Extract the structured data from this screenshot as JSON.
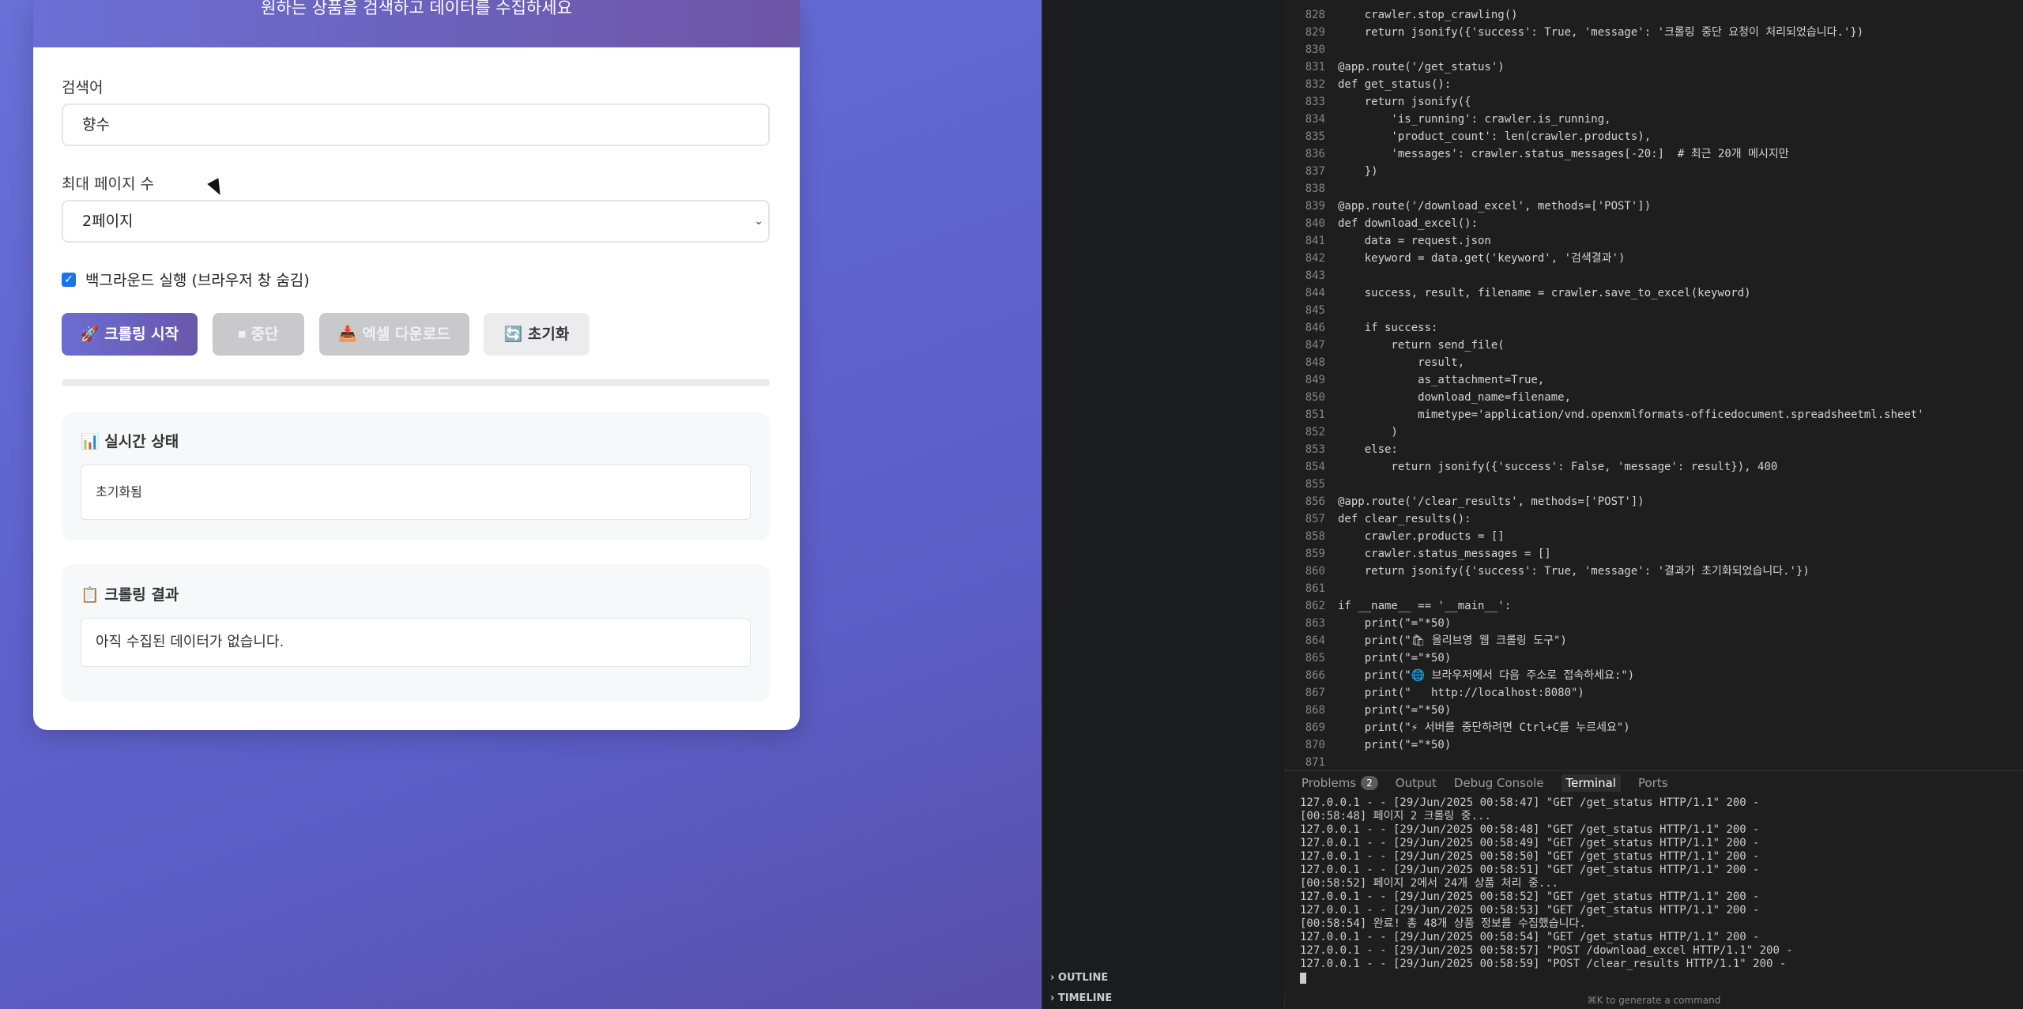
{
  "browser": {
    "header_subtitle": "원하는 상품을 검색하고 데이터를 수집하세요",
    "keyword_label": "검색어",
    "keyword_value": "향수",
    "pages_label": "최대 페이지 수",
    "pages_value": "2페이지",
    "background_checkbox_label": "백그라운드 실행 (브라우저 창 숨김)",
    "background_checked": true,
    "buttons": {
      "start": "🚀 크롤링 시작",
      "stop": "⏹ 중단",
      "download": "📥 엑셀 다운로드",
      "reset": "🔄 초기화"
    },
    "status_title": "📊 실시간 상태",
    "status_text": "초기화됨",
    "results_title": "📋 크롤링 결과",
    "results_text": "아직 수집된 데이터가 없습니다."
  },
  "editor": {
    "side_sections": [
      "OUTLINE",
      "TIMELINE"
    ],
    "code_lines": [
      {
        "num": "828",
        "text": "    crawler.stop_crawling()"
      },
      {
        "num": "829",
        "text": "    return jsonify({'success': True, 'message': '크롤링 중단 요청이 처리되었습니다.'})"
      },
      {
        "num": "830",
        "text": ""
      },
      {
        "num": "831",
        "text": "@app.route('/get_status')"
      },
      {
        "num": "832",
        "text": "def get_status():"
      },
      {
        "num": "833",
        "text": "    return jsonify({"
      },
      {
        "num": "834",
        "text": "        'is_running': crawler.is_running,"
      },
      {
        "num": "835",
        "text": "        'product_count': len(crawler.products),"
      },
      {
        "num": "836",
        "text": "        'messages': crawler.status_messages[-20:]  # 최근 20개 메시지만"
      },
      {
        "num": "837",
        "text": "    })"
      },
      {
        "num": "838",
        "text": ""
      },
      {
        "num": "839",
        "text": "@app.route('/download_excel', methods=['POST'])"
      },
      {
        "num": "840",
        "text": "def download_excel():"
      },
      {
        "num": "841",
        "text": "    data = request.json"
      },
      {
        "num": "842",
        "text": "    keyword = data.get('keyword', '검색결과')"
      },
      {
        "num": "843",
        "text": ""
      },
      {
        "num": "844",
        "text": "    success, result, filename = crawler.save_to_excel(keyword)"
      },
      {
        "num": "845",
        "text": ""
      },
      {
        "num": "846",
        "text": "    if success:"
      },
      {
        "num": "847",
        "text": "        return send_file("
      },
      {
        "num": "848",
        "text": "            result,"
      },
      {
        "num": "849",
        "text": "            as_attachment=True,"
      },
      {
        "num": "850",
        "text": "            download_name=filename,"
      },
      {
        "num": "851",
        "text": "            mimetype='application/vnd.openxmlformats-officedocument.spreadsheetml.sheet'"
      },
      {
        "num": "852",
        "text": "        )"
      },
      {
        "num": "853",
        "text": "    else:"
      },
      {
        "num": "854",
        "text": "        return jsonify({'success': False, 'message': result}), 400"
      },
      {
        "num": "855",
        "text": ""
      },
      {
        "num": "856",
        "text": "@app.route('/clear_results', methods=['POST'])"
      },
      {
        "num": "857",
        "text": "def clear_results():"
      },
      {
        "num": "858",
        "text": "    crawler.products = []"
      },
      {
        "num": "859",
        "text": "    crawler.status_messages = []"
      },
      {
        "num": "860",
        "text": "    return jsonify({'success': True, 'message': '결과가 초기화되었습니다.'})"
      },
      {
        "num": "861",
        "text": ""
      },
      {
        "num": "862",
        "text": "if __name__ == '__main__':"
      },
      {
        "num": "863",
        "text": "    print(\"=\"*50)"
      },
      {
        "num": "864",
        "text": "    print(\"🛍 올리브영 웹 크롤링 도구\")"
      },
      {
        "num": "865",
        "text": "    print(\"=\"*50)"
      },
      {
        "num": "866",
        "text": "    print(\"🌐 브라우저에서 다음 주소로 접속하세요:\")"
      },
      {
        "num": "867",
        "text": "    print(\"   http://localhost:8080\")"
      },
      {
        "num": "868",
        "text": "    print(\"=\"*50)"
      },
      {
        "num": "869",
        "text": "    print(\"⚡ 서버를 중단하려면 Ctrl+C를 누르세요\")"
      },
      {
        "num": "870",
        "text": "    print(\"=\"*50)"
      },
      {
        "num": "871",
        "text": ""
      }
    ],
    "panel_tabs": {
      "problems": "Problems",
      "problems_count": "2",
      "output": "Output",
      "debug": "Debug Console",
      "terminal": "Terminal",
      "ports": "Ports"
    },
    "terminal_lines": [
      "127.0.0.1 - - [29/Jun/2025 00:58:47] \"GET /get_status HTTP/1.1\" 200 -",
      "[00:58:48] 페이지 2 크롤링 중...",
      "127.0.0.1 - - [29/Jun/2025 00:58:48] \"GET /get_status HTTP/1.1\" 200 -",
      "127.0.0.1 - - [29/Jun/2025 00:58:49] \"GET /get_status HTTP/1.1\" 200 -",
      "127.0.0.1 - - [29/Jun/2025 00:58:50] \"GET /get_status HTTP/1.1\" 200 -",
      "127.0.0.1 - - [29/Jun/2025 00:58:51] \"GET /get_status HTTP/1.1\" 200 -",
      "[00:58:52] 페이지 2에서 24개 상품 처리 중...",
      "127.0.0.1 - - [29/Jun/2025 00:58:52] \"GET /get_status HTTP/1.1\" 200 -",
      "127.0.0.1 - - [29/Jun/2025 00:58:53] \"GET /get_status HTTP/1.1\" 200 -",
      "[00:58:54] 완료! 총 48개 상품 정보를 수집했습니다.",
      "127.0.0.1 - - [29/Jun/2025 00:58:54] \"GET /get_status HTTP/1.1\" 200 -",
      "127.0.0.1 - - [29/Jun/2025 00:58:57] \"POST /download_excel HTTP/1.1\" 200 -",
      "127.0.0.1 - - [29/Jun/2025 00:58:59] \"POST /clear_results HTTP/1.1\" 200 -"
    ],
    "hint": "⌘K to generate a command"
  },
  "colors": {
    "accent_start": "#6c6fd5",
    "accent_end": "#6d55a6",
    "editor_bg": "#1e1e1e"
  }
}
